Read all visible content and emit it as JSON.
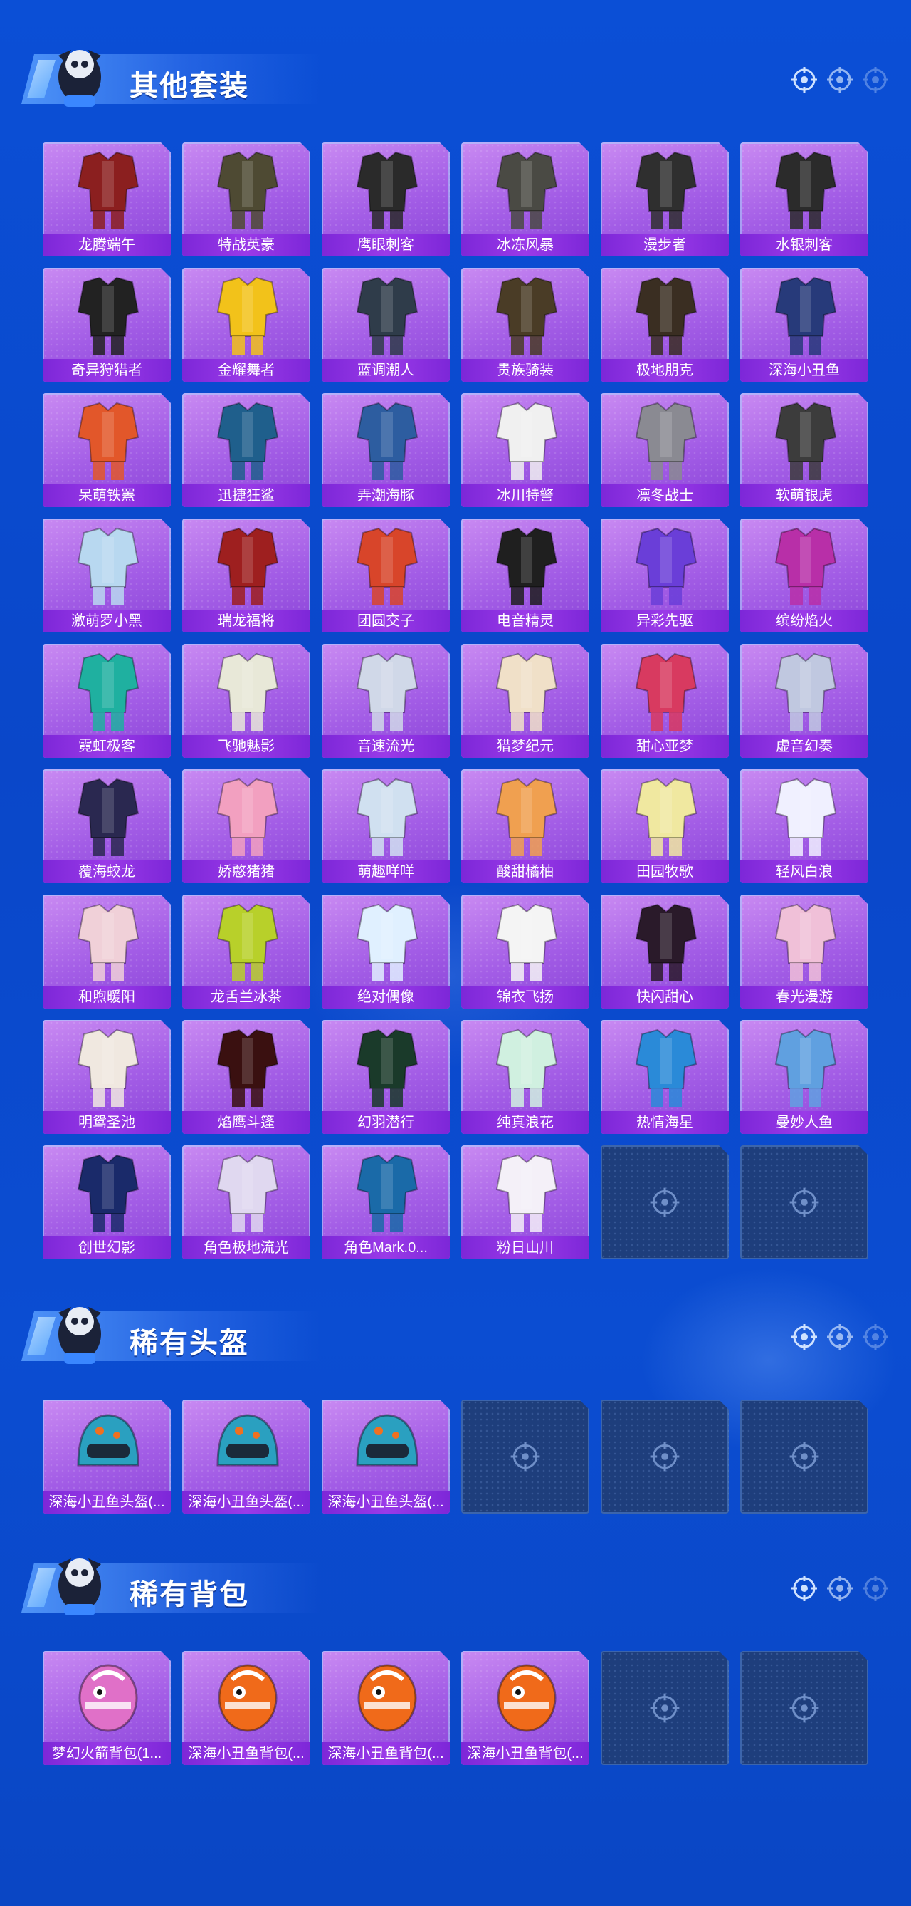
{
  "sections": {
    "suits": {
      "title": "其他套装",
      "items": [
        {
          "name": "龙腾端午",
          "color": "#8b1f1f"
        },
        {
          "name": "特战英豪",
          "color": "#4e4a33"
        },
        {
          "name": "鹰眼刺客",
          "color": "#2a2a2a"
        },
        {
          "name": "冰冻风暴",
          "color": "#4a4a44"
        },
        {
          "name": "漫步者",
          "color": "#2f2f2f"
        },
        {
          "name": "水银刺客",
          "color": "#2b2b2b"
        },
        {
          "name": "奇异狩猎者",
          "color": "#222222"
        },
        {
          "name": "金耀舞者",
          "color": "#f2c21a"
        },
        {
          "name": "蓝调潮人",
          "color": "#2f3c4a"
        },
        {
          "name": "贵族骑装",
          "color": "#4a3c26"
        },
        {
          "name": "极地朋克",
          "color": "#3a2e22"
        },
        {
          "name": "深海小丑鱼",
          "color": "#273a7a"
        },
        {
          "name": "呆萌铁罴",
          "color": "#e2572a"
        },
        {
          "name": "迅捷狂鲨",
          "color": "#1f5f8c"
        },
        {
          "name": "弄潮海豚",
          "color": "#2d5da0"
        },
        {
          "name": "冰川特警",
          "color": "#f0f0f0"
        },
        {
          "name": "凛冬战士",
          "color": "#8a8a92"
        },
        {
          "name": "软萌银虎",
          "color": "#3c3c3c"
        },
        {
          "name": "激萌罗小黑",
          "color": "#b8d8f0"
        },
        {
          "name": "瑞龙福将",
          "color": "#9e1f1f"
        },
        {
          "name": "团圆交子",
          "color": "#d8452a"
        },
        {
          "name": "电音精灵",
          "color": "#1f1f1f"
        },
        {
          "name": "异彩先驱",
          "color": "#6a3ed8"
        },
        {
          "name": "缤纷焰火",
          "color": "#b82fa8"
        },
        {
          "name": "霓虹极客",
          "color": "#1fb0a0"
        },
        {
          "name": "飞驰魅影",
          "color": "#e8e8d8"
        },
        {
          "name": "音速流光",
          "color": "#d0d8e8"
        },
        {
          "name": "猎梦纪元",
          "color": "#f0e0c8"
        },
        {
          "name": "甜心亚梦",
          "color": "#d83a60"
        },
        {
          "name": "虚音幻奏",
          "color": "#c0c8e0"
        },
        {
          "name": "覆海蛟龙",
          "color": "#2a2850"
        },
        {
          "name": "娇憨猪猪",
          "color": "#f2a0c0"
        },
        {
          "name": "萌趣咩咩",
          "color": "#d0e0f0"
        },
        {
          "name": "酸甜橘柚",
          "color": "#f0a050"
        },
        {
          "name": "田园牧歌",
          "color": "#f0e8a0"
        },
        {
          "name": "轻风白浪",
          "color": "#f0f0ff"
        },
        {
          "name": "和煦暖阳",
          "color": "#f0d0d8"
        },
        {
          "name": "龙舌兰冰茶",
          "color": "#b8d02a"
        },
        {
          "name": "绝对偶像",
          "color": "#e0f0ff"
        },
        {
          "name": "锦衣飞扬",
          "color": "#f4f4f4"
        },
        {
          "name": "快闪甜心",
          "color": "#2a1a2a"
        },
        {
          "name": "春光漫游",
          "color": "#f0c0d8"
        },
        {
          "name": "明鸳圣池",
          "color": "#f0e8e0"
        },
        {
          "name": "焰鹰斗篷",
          "color": "#3a1010"
        },
        {
          "name": "幻羽潜行",
          "color": "#1a3a2a"
        },
        {
          "name": "纯真浪花",
          "color": "#d0f0e0"
        },
        {
          "name": "热情海星",
          "color": "#2a8ad8"
        },
        {
          "name": "曼妙人鱼",
          "color": "#60a0e0"
        },
        {
          "name": "创世幻影",
          "color": "#1a2a6a"
        },
        {
          "name": "角色极地流光",
          "color": "#e0d8f0"
        },
        {
          "name": "角色Mark.0...",
          "color": "#1a6aa8"
        },
        {
          "name": "粉日山川",
          "color": "#f4f0f8"
        }
      ],
      "empty_slots": 2
    },
    "helmets": {
      "title": "稀有头盔",
      "items": [
        {
          "name": "深海小丑鱼头盔(...",
          "color": "#2aa0c0"
        },
        {
          "name": "深海小丑鱼头盔(...",
          "color": "#2aa0c0"
        },
        {
          "name": "深海小丑鱼头盔(...",
          "color": "#2aa0c0"
        }
      ],
      "empty_slots": 3
    },
    "backpacks": {
      "title": "稀有背包",
      "items": [
        {
          "name": "梦幻火箭背包(1...",
          "color": "#e070c8"
        },
        {
          "name": "深海小丑鱼背包(...",
          "color": "#f06a1a"
        },
        {
          "name": "深海小丑鱼背包(...",
          "color": "#f06a1a"
        },
        {
          "name": "深海小丑鱼背包(...",
          "color": "#f06a1a"
        }
      ],
      "empty_slots": 2
    }
  },
  "icons": {
    "target": "crosshair-target-icon",
    "mascot": "mascot-icon"
  },
  "colors": {
    "background": "#0b4dd2",
    "card": "#a35de6",
    "label_bar": "#7d27d8",
    "empty_slot": "#1e3e7c"
  }
}
